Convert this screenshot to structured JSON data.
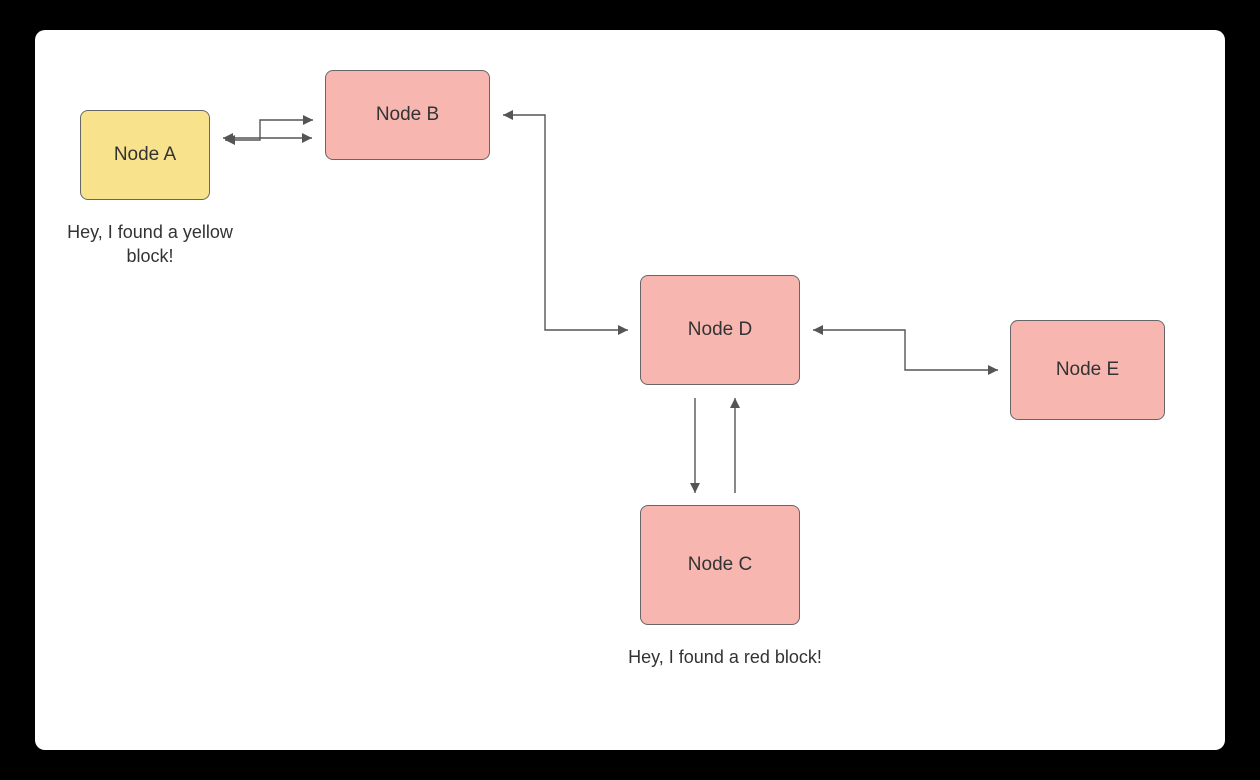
{
  "nodes": {
    "a": {
      "label": "Node A",
      "color": "yellow"
    },
    "b": {
      "label": "Node B",
      "color": "red"
    },
    "c": {
      "label": "Node C",
      "color": "red"
    },
    "d": {
      "label": "Node D",
      "color": "red"
    },
    "e": {
      "label": "Node E",
      "color": "red"
    }
  },
  "captions": {
    "a": "Hey, I found a yellow block!",
    "c": "Hey, I found a red block!"
  },
  "edges": [
    {
      "from": "A",
      "to": "B",
      "bidirectional": true
    },
    {
      "from": "B",
      "to": "D",
      "bidirectional": true
    },
    {
      "from": "D",
      "to": "C",
      "bidirectional": true
    },
    {
      "from": "D",
      "to": "E",
      "bidirectional": true
    }
  ],
  "colors": {
    "yellow": "#f8e38c",
    "red": "#f7b7b0",
    "edge": "#555555"
  }
}
